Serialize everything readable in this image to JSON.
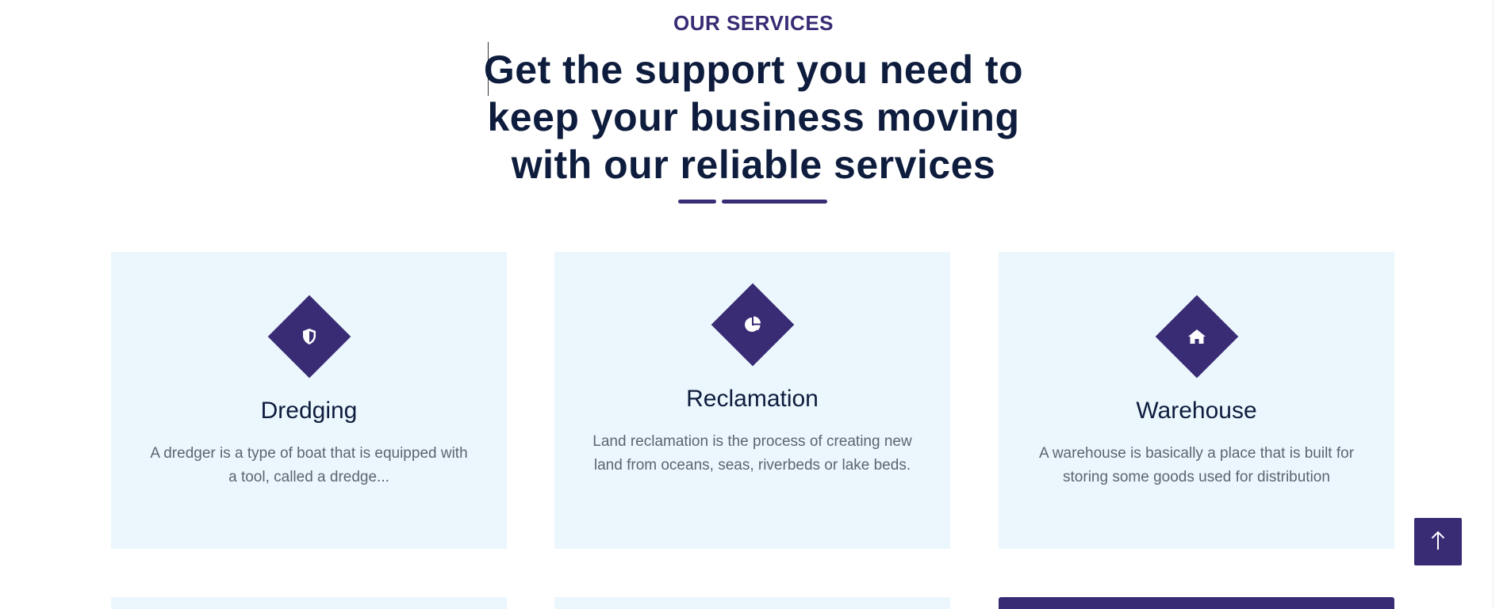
{
  "section": {
    "eyebrow": "OUR SERVICES",
    "heading_lines": [
      "Get the support you need to",
      "keep your business moving",
      "with our reliable services"
    ]
  },
  "services": [
    {
      "title": "Dredging",
      "description": "A dredger is a type of boat that is equipped with a tool, called a dredge...",
      "icon": "shield-icon"
    },
    {
      "title": "Reclamation",
      "description": "Land reclamation is the process of creating new land from oceans, seas, riverbeds or lake beds.",
      "icon": "pie-chart-icon"
    },
    {
      "title": "Warehouse",
      "description": "A warehouse is basically a place that is built for storing some goods used for distribution",
      "icon": "home-icon"
    }
  ],
  "scroll_top": {
    "icon": "arrow-up-icon"
  },
  "colors": {
    "accent": "#392b74",
    "heading": "#0e1c3d",
    "card_background": "#ebf7fd",
    "body_text": "#5f6470"
  }
}
